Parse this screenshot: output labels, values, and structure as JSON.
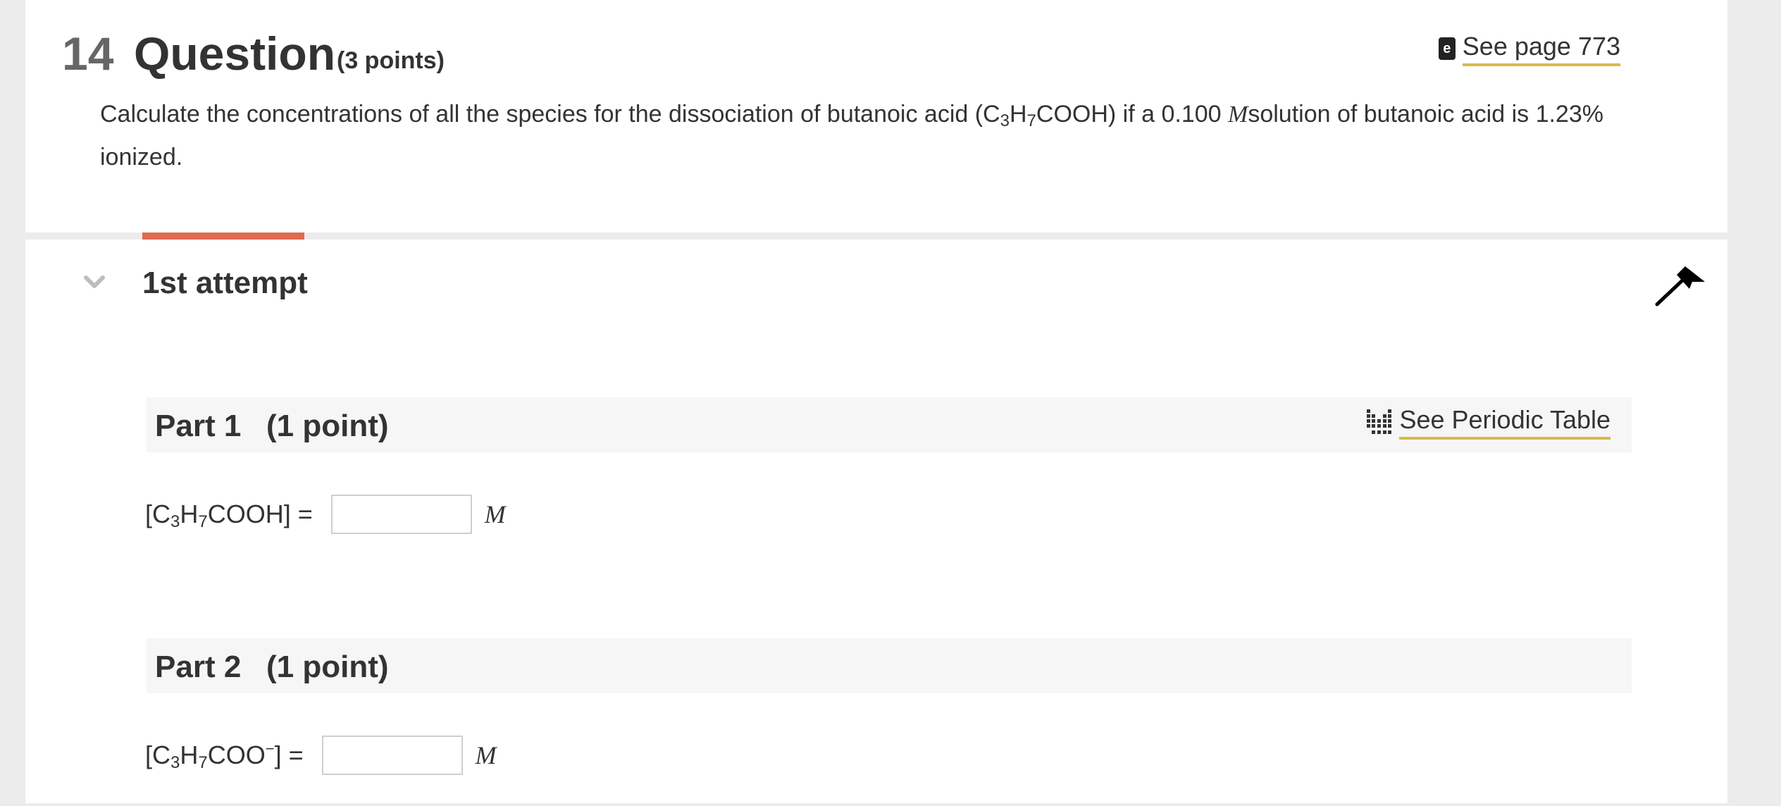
{
  "question": {
    "number": "14",
    "title": "Question",
    "points": "(3 points)",
    "see_page_icon": "ebook-icon",
    "see_page_label": "See page 773",
    "text": {
      "part1": "Calculate the concentrations of all the species for the dissociation of butanoic acid (C",
      "sub1": "3",
      "part2": "H",
      "sub2": "7",
      "part3": "COOH) if a 0.100 ",
      "unit": "M",
      "part4": "solution of butanoic acid is 1.23% ionized."
    }
  },
  "attempt": {
    "title": "1st attempt",
    "chevron_icon": "chevron-down-icon",
    "flag_icon": "flag-icon",
    "accent_color": "#e06a4e"
  },
  "parts": [
    {
      "label": "Part 1",
      "points": "(1 point)",
      "periodic_icon": "periodic-table-icon",
      "periodic_label": "See Periodic Table",
      "formula": {
        "open": "[C",
        "sub1": "3",
        "mid": "H",
        "sub2": "7",
        "rest": "COOH]",
        "sup": "",
        "close": " ="
      },
      "input_value": "",
      "unit": "M"
    },
    {
      "label": "Part 2",
      "points": "(1 point)",
      "formula": {
        "open": "[C",
        "sub1": "3",
        "mid": "H",
        "sub2": "7",
        "rest": "COO",
        "sup": "−",
        "close": "] ="
      },
      "input_value": "",
      "unit": "M"
    }
  ],
  "colors": {
    "link_underline": "#d8b94c",
    "background": "#ececec",
    "part_header": "#f6f6f6"
  }
}
